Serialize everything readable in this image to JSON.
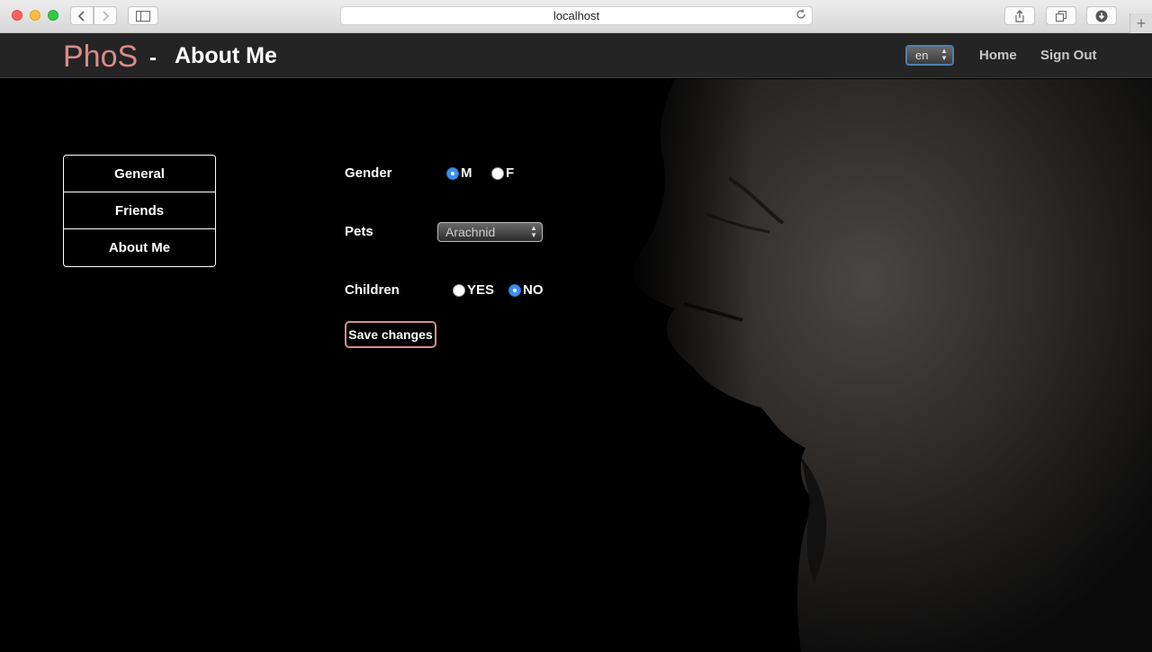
{
  "browser": {
    "url": "localhost",
    "new_tab_glyph": "+"
  },
  "header": {
    "brand": "PhoS",
    "separator": "-",
    "title": "About Me",
    "language": "en",
    "nav": {
      "home": "Home",
      "sign_out": "Sign Out"
    }
  },
  "sidebar": {
    "items": [
      {
        "label": "General"
      },
      {
        "label": "Friends"
      },
      {
        "label": "About Me"
      }
    ]
  },
  "form": {
    "gender": {
      "label": "Gender",
      "options": [
        "M",
        "F"
      ],
      "selected": "M"
    },
    "pets": {
      "label": "Pets",
      "value": "Arachnid"
    },
    "children": {
      "label": "Children",
      "options": [
        "YES",
        "NO"
      ],
      "selected": "NO"
    },
    "save_label": "Save changes"
  },
  "colors": {
    "brand": "#d98b8b",
    "header_bg": "#242424",
    "radio_checked": "#3b8ef0"
  },
  "icons": [
    "back-icon",
    "forward-icon",
    "sidebar-icon",
    "share-icon",
    "tabs-icon",
    "download-icon",
    "reload-icon"
  ]
}
